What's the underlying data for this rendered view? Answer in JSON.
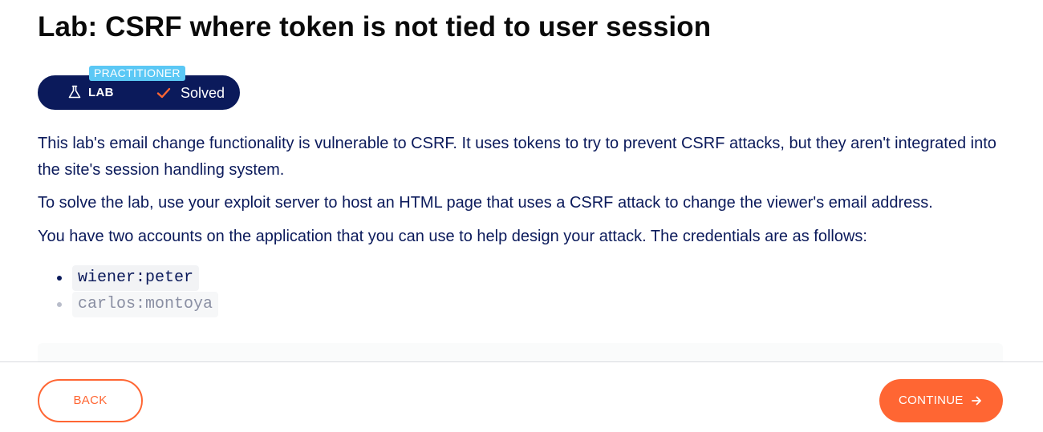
{
  "lab": {
    "title": "Lab: CSRF where token is not tied to user session",
    "level": "PRACTITIONER",
    "lab_label": "LAB",
    "status": "Solved",
    "description": [
      "This lab's email change functionality is vulnerable to CSRF. It uses tokens to try to prevent CSRF attacks, but they aren't integrated into the site's session handling system.",
      "To solve the lab, use your exploit server to host an HTML page that uses a CSRF attack to change the viewer's email address.",
      "You have two accounts on the application that you can use to help design your attack. The credentials are as follows:"
    ],
    "credentials": [
      "wiener:peter",
      "carlos:montoya"
    ]
  },
  "footer": {
    "back_label": "BACK",
    "continue_label": "CONTINUE"
  },
  "icons": {
    "lab": "flask-icon",
    "status": "check-icon",
    "continue": "arrow-right-icon"
  },
  "colors": {
    "accent": "#ff6633",
    "navy": "#0b1a5b",
    "level_badge": "#5bc8f5"
  }
}
